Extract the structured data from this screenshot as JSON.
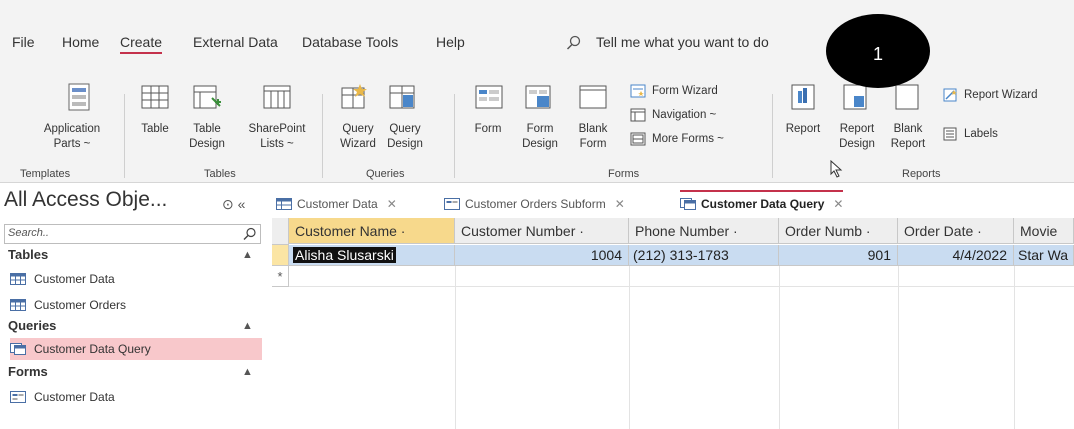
{
  "menu": {
    "items": [
      "File",
      "Home",
      "Create",
      "External Data",
      "Database Tools",
      "Help"
    ],
    "active": "Create",
    "tell_me": "Tell me what you want to do"
  },
  "badge": "1",
  "ribbon": {
    "templates": {
      "application_parts": [
        "Application",
        "Parts ~"
      ],
      "label": "Templates"
    },
    "tables": {
      "table": "Table",
      "table_design": [
        "Table",
        "Design"
      ],
      "sharepoint_lists": [
        "SharePoint",
        "Lists ~"
      ],
      "label": "Tables"
    },
    "queries": {
      "query_wizard": [
        "Query",
        "Wizard"
      ],
      "query_design": [
        "Query",
        "Design"
      ],
      "label": "Queries"
    },
    "forms": {
      "form": "Form",
      "form_design": [
        "Form",
        "Design"
      ],
      "blank_form": [
        "Blank",
        "Form"
      ],
      "form_wizard": "Form Wizard",
      "navigation": "Navigation ~",
      "more_forms": "More Forms ~",
      "label": "Forms"
    },
    "reports": {
      "report": "Report",
      "report_design": [
        "Report",
        "Design"
      ],
      "blank_report": [
        "Blank",
        "Report"
      ],
      "report_wizard": "Report Wizard",
      "labels": "Labels",
      "label": "Reports"
    }
  },
  "nav": {
    "title": "All Access Obje...",
    "buttons": "⊙ «",
    "search_placeholder": "Search..",
    "sections": [
      {
        "name": "Tables",
        "items": [
          "Customer Data",
          "Customer Orders"
        ]
      },
      {
        "name": "Queries",
        "items": [
          "Customer Data Query"
        ]
      },
      {
        "name": "Forms",
        "items": [
          "Customer Data"
        ]
      }
    ],
    "selected_item": "Customer Data Query"
  },
  "tabs": [
    {
      "label": "Customer Data",
      "active": false
    },
    {
      "label": "Customer Orders Subform",
      "active": false
    },
    {
      "label": "Customer Data Query",
      "active": true
    }
  ],
  "grid": {
    "columns": [
      "Customer Name ·",
      "Customer Number ·",
      "Phone Number ·",
      "Order Numb ·",
      "Order Date ·",
      "Movie"
    ],
    "rows": [
      [
        "Alisha Slusarski",
        "1004",
        "(212) 313-1783",
        "901",
        "4/4/2022",
        "Star Wa"
      ]
    ],
    "new_row_marker": "*"
  },
  "colors": {
    "accent": "#c4314b",
    "row_highlight": "#c9dcf1",
    "selected_header": "#f7d98c",
    "nav_selected": "#f8c8cb"
  }
}
